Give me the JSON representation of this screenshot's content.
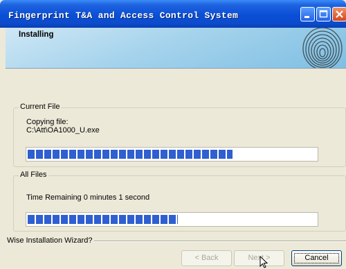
{
  "window": {
    "title": "Fingerprint T&A and Access Control System"
  },
  "header": {
    "title": "Installing"
  },
  "current_file": {
    "legend": "Current File",
    "action": "Copying file:",
    "path": "C:\\Att\\OA1000_U.exe",
    "progress": 0.71
  },
  "all_files": {
    "legend": "All Files",
    "time_remaining": "Time Remaining 0 minutes 1 second",
    "progress": 0.52
  },
  "footer": {
    "brand": "Wise Installation Wizard?"
  },
  "buttons": {
    "back": {
      "label": "< Back",
      "enabled": false
    },
    "next": {
      "label": "Next >",
      "enabled": false
    },
    "cancel": {
      "label": "Cancel",
      "enabled": true
    }
  },
  "icons": {
    "minimize": "minimize-icon",
    "maximize": "maximize-icon",
    "close": "close-icon",
    "fingerprint": "fingerprint-icon"
  },
  "colors": {
    "titlebar": "#0a4fd6",
    "progress_fill": "#2f5fd0"
  }
}
